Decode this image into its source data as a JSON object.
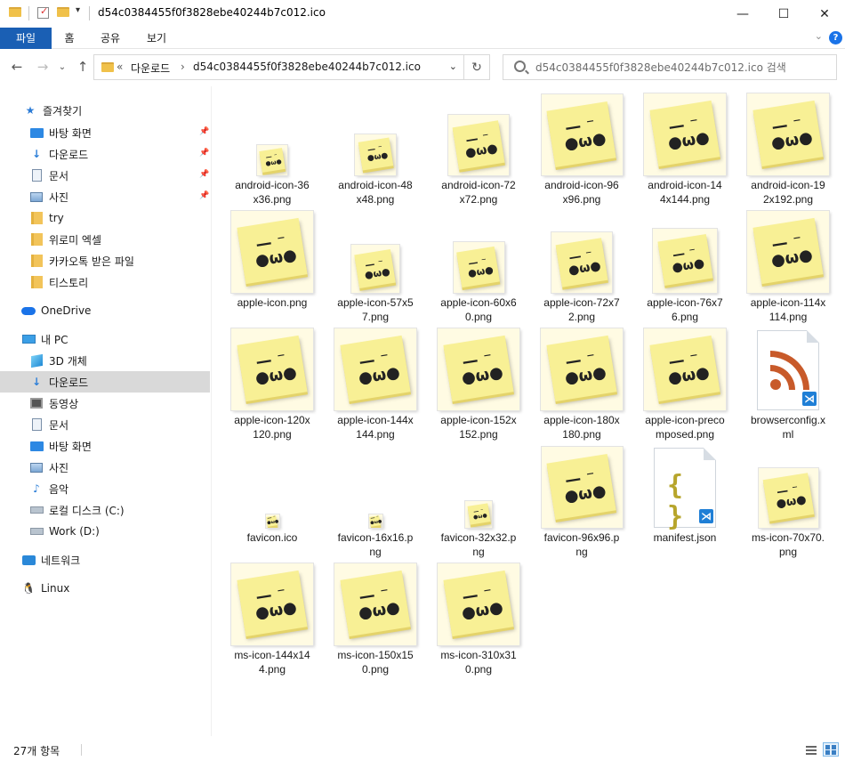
{
  "window": {
    "title": "d54c0384455f0f3828ebe40244b7c012.ico",
    "minimize": "—",
    "maximize": "☐",
    "close": "✕"
  },
  "ribbon": {
    "tabs": [
      "파일",
      "홈",
      "공유",
      "보기"
    ],
    "help": "?"
  },
  "nav": {
    "back": "←",
    "forward": "→",
    "recent": "⌄",
    "up": "↑",
    "address_prefix": "«",
    "breadcrumbs": [
      "다운로드",
      "d54c0384455f0f3828ebe40244b7c012.ico"
    ],
    "search_placeholder": "d54c0384455f0f3828ebe40244b7c012.ico 검색"
  },
  "sidebar": {
    "quick_access": "즐겨찾기",
    "quick_items": [
      {
        "label": "바탕 화면",
        "icon": "desktop-icon",
        "pinned": true
      },
      {
        "label": "다운로드",
        "icon": "download-icon",
        "pinned": true
      },
      {
        "label": "문서",
        "icon": "document-icon",
        "pinned": true
      },
      {
        "label": "사진",
        "icon": "pictures-icon",
        "pinned": true
      },
      {
        "label": "try",
        "icon": "folder-icon",
        "pinned": false
      },
      {
        "label": "위로미 엑셀",
        "icon": "folder-icon",
        "pinned": false
      },
      {
        "label": "카카오톡 받은 파일",
        "icon": "folder-icon",
        "pinned": false
      },
      {
        "label": "티스토리",
        "icon": "folder-icon",
        "pinned": false
      }
    ],
    "onedrive": "OneDrive",
    "this_pc": "내 PC",
    "pc_items": [
      {
        "label": "3D 개체",
        "icon": "3d-objects-icon"
      },
      {
        "label": "다운로드",
        "icon": "download-icon",
        "selected": true
      },
      {
        "label": "동영상",
        "icon": "videos-icon"
      },
      {
        "label": "문서",
        "icon": "document-icon"
      },
      {
        "label": "바탕 화면",
        "icon": "desktop-icon"
      },
      {
        "label": "사진",
        "icon": "pictures-icon"
      },
      {
        "label": "음악",
        "icon": "music-icon"
      },
      {
        "label": "로컬 디스크 (C:)",
        "icon": "drive-icon"
      },
      {
        "label": "Work (D:)",
        "icon": "drive-icon"
      }
    ],
    "network": "네트워크",
    "linux": "Linux"
  },
  "files": [
    {
      "name": "android-icon-36x36.png",
      "lines": [
        "android-icon-36",
        "x36.png"
      ],
      "kind": "image",
      "size": 36
    },
    {
      "name": "android-icon-48x48.png",
      "lines": [
        "android-icon-48",
        "x48.png"
      ],
      "kind": "image",
      "size": 48
    },
    {
      "name": "android-icon-72x72.png",
      "lines": [
        "android-icon-72",
        "x72.png"
      ],
      "kind": "image",
      "size": 72
    },
    {
      "name": "android-icon-96x96.png",
      "lines": [
        "android-icon-96",
        "x96.png"
      ],
      "kind": "image",
      "size": 96
    },
    {
      "name": "android-icon-144x144.png",
      "lines": [
        "android-icon-14",
        "4x144.png"
      ],
      "kind": "image",
      "size": 144
    },
    {
      "name": "android-icon-192x192.png",
      "lines": [
        "android-icon-19",
        "2x192.png"
      ],
      "kind": "image",
      "size": 192
    },
    {
      "name": "apple-icon.png",
      "lines": [
        "apple-icon.png"
      ],
      "kind": "image",
      "size": 192
    },
    {
      "name": "apple-icon-57x57.png",
      "lines": [
        "apple-icon-57x5",
        "7.png"
      ],
      "kind": "image",
      "size": 57
    },
    {
      "name": "apple-icon-60x60.png",
      "lines": [
        "apple-icon-60x6",
        "0.png"
      ],
      "kind": "image",
      "size": 60
    },
    {
      "name": "apple-icon-72x72.png",
      "lines": [
        "apple-icon-72x7",
        "2.png"
      ],
      "kind": "image",
      "size": 72
    },
    {
      "name": "apple-icon-76x76.png",
      "lines": [
        "apple-icon-76x7",
        "6.png"
      ],
      "kind": "image",
      "size": 76
    },
    {
      "name": "apple-icon-114x114.png",
      "lines": [
        "apple-icon-114x",
        "114.png"
      ],
      "kind": "image",
      "size": 114
    },
    {
      "name": "apple-icon-120x120.png",
      "lines": [
        "apple-icon-120x",
        "120.png"
      ],
      "kind": "image",
      "size": 120
    },
    {
      "name": "apple-icon-144x144.png",
      "lines": [
        "apple-icon-144x",
        "144.png"
      ],
      "kind": "image",
      "size": 144
    },
    {
      "name": "apple-icon-152x152.png",
      "lines": [
        "apple-icon-152x",
        "152.png"
      ],
      "kind": "image",
      "size": 152
    },
    {
      "name": "apple-icon-180x180.png",
      "lines": [
        "apple-icon-180x",
        "180.png"
      ],
      "kind": "image",
      "size": 180
    },
    {
      "name": "apple-icon-precomposed.png",
      "lines": [
        "apple-icon-preco",
        "mposed.png"
      ],
      "kind": "image",
      "size": 192
    },
    {
      "name": "browserconfig.xml",
      "lines": [
        "browserconfig.x",
        "ml"
      ],
      "kind": "xml"
    },
    {
      "name": "favicon.ico",
      "lines": [
        "favicon.ico"
      ],
      "kind": "image",
      "size": 16
    },
    {
      "name": "favicon-16x16.png",
      "lines": [
        "favicon-16x16.p",
        "ng"
      ],
      "kind": "image",
      "size": 16
    },
    {
      "name": "favicon-32x32.png",
      "lines": [
        "favicon-32x32.p",
        "ng"
      ],
      "kind": "image",
      "size": 32
    },
    {
      "name": "favicon-96x96.png",
      "lines": [
        "favicon-96x96.p",
        "ng"
      ],
      "kind": "image",
      "size": 96
    },
    {
      "name": "manifest.json",
      "lines": [
        "manifest.json"
      ],
      "kind": "json"
    },
    {
      "name": "ms-icon-70x70.png",
      "lines": [
        "ms-icon-70x70.",
        "png"
      ],
      "kind": "image",
      "size": 70
    },
    {
      "name": "ms-icon-144x144.png",
      "lines": [
        "ms-icon-144x14",
        "4.png"
      ],
      "kind": "image",
      "size": 144
    },
    {
      "name": "ms-icon-150x150.png",
      "lines": [
        "ms-icon-150x15",
        "0.png"
      ],
      "kind": "image",
      "size": 150
    },
    {
      "name": "ms-icon-310x310.png",
      "lines": [
        "ms-icon-310x31",
        "0.png"
      ],
      "kind": "image",
      "size": 310
    }
  ],
  "status": {
    "item_count": "27개 항목"
  },
  "colors": {
    "accent": "#1a5fb4",
    "selected_row": "#d9d9d9",
    "note_yellow": "#f8f095"
  }
}
